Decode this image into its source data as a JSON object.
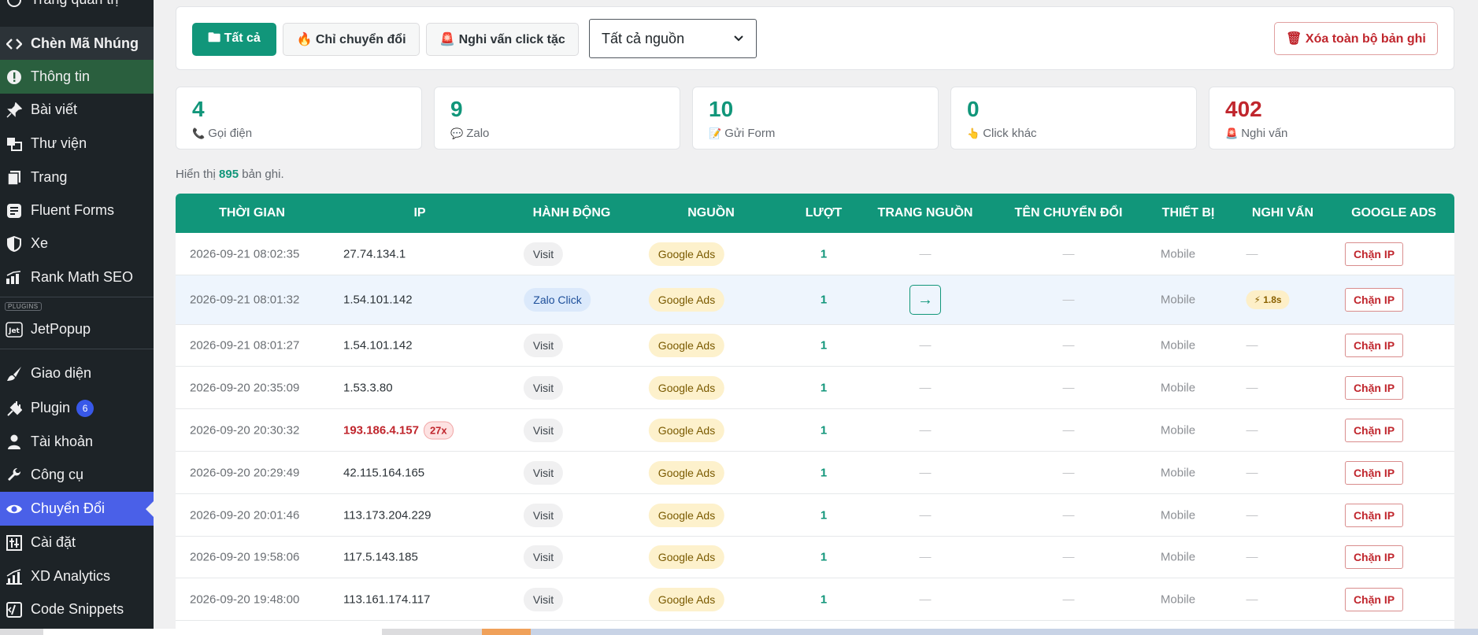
{
  "sidebar": {
    "items": [
      {
        "label": "Trang quản trị",
        "icon": "dashboard-icon"
      },
      {
        "label": "Chèn Mã Nhúng",
        "icon": "code-icon"
      },
      {
        "label": "Thông tin",
        "icon": "info-icon"
      },
      {
        "label": "Bài viết",
        "icon": "pin-icon"
      },
      {
        "label": "Thư viện",
        "icon": "media-icon"
      },
      {
        "label": "Trang",
        "icon": "page-icon"
      },
      {
        "label": "Fluent Forms",
        "icon": "form-icon"
      },
      {
        "label": "Xe",
        "icon": "shield-icon"
      },
      {
        "label": "Rank Math SEO",
        "icon": "chart-icon"
      },
      {
        "label": "JetPopup",
        "icon": "jet-icon"
      },
      {
        "label": "Giao diện",
        "icon": "brush-icon"
      },
      {
        "label": "Plugin",
        "icon": "plugin-icon",
        "badge": "6"
      },
      {
        "label": "Tài khoản",
        "icon": "user-icon"
      },
      {
        "label": "Công cụ",
        "icon": "wrench-icon"
      },
      {
        "label": "Chuyển Đổi",
        "icon": "eye-icon"
      },
      {
        "label": "Cài đặt",
        "icon": "settings-icon"
      },
      {
        "label": "XD Analytics",
        "icon": "analytics-icon"
      },
      {
        "label": "Code Snippets",
        "icon": "snippet-icon"
      }
    ],
    "plugins_tag": "PLUGINS"
  },
  "toolbar": {
    "filter_all": "🖿 Tất cả",
    "filter_conversion": "🔥 Chỉ chuyển đổi",
    "filter_suspicious": "🚨 Nghi vấn click tặc",
    "source_select": "Tất cả nguồn",
    "delete_all": "🗑 Xóa toàn bộ bản ghi"
  },
  "stats": [
    {
      "value": "4",
      "emoji": "📞",
      "label": "Gọi điện"
    },
    {
      "value": "9",
      "emoji": "💬",
      "label": "Zalo"
    },
    {
      "value": "10",
      "emoji": "📝",
      "label": "Gửi Form"
    },
    {
      "value": "0",
      "emoji": "👆",
      "label": "Click khác"
    },
    {
      "value": "402",
      "emoji": "🚨",
      "label": "Nghi vấn"
    }
  ],
  "showing": {
    "prefix": "Hiển thị",
    "count": "895",
    "suffix": "bản ghi."
  },
  "table": {
    "headers": [
      "THỜI GIAN",
      "IP",
      "HÀNH ĐỘNG",
      "NGUỒN",
      "LƯỢT",
      "TRANG NGUỒN",
      "TÊN CHUYỂN ĐỔI",
      "THIẾT BỊ",
      "NGHI VẤN",
      "GOOGLE ADS"
    ],
    "dash": "—",
    "rows": [
      {
        "time": "2026-09-21 08:02:35",
        "ip": "27.74.134.1",
        "action": "Visit",
        "source": "Google Ads",
        "turns": "1",
        "device": "Mobile",
        "block": "Chặn IP"
      },
      {
        "time": "2026-09-21 08:01:32",
        "ip": "1.54.101.142",
        "action": "Zalo Click",
        "source": "Google Ads",
        "turns": "1",
        "arrow": "→",
        "device": "Mobile",
        "suspect": "⚡ 1.8s",
        "block": "Chặn IP"
      },
      {
        "time": "2026-09-21 08:01:27",
        "ip": "1.54.101.142",
        "action": "Visit",
        "source": "Google Ads",
        "turns": "1",
        "device": "Mobile",
        "block": "Chặn IP"
      },
      {
        "time": "2026-09-20 20:35:09",
        "ip": "1.53.3.80",
        "action": "Visit",
        "source": "Google Ads",
        "turns": "1",
        "device": "Mobile",
        "block": "Chặn IP"
      },
      {
        "time": "2026-09-20 20:30:32",
        "ip": "193.186.4.157",
        "ip_count": "27x",
        "action": "Visit",
        "source": "Google Ads",
        "turns": "1",
        "device": "Mobile",
        "block": "Chặn IP"
      },
      {
        "time": "2026-09-20 20:29:49",
        "ip": "42.115.164.165",
        "action": "Visit",
        "source": "Google Ads",
        "turns": "1",
        "device": "Mobile",
        "block": "Chặn IP"
      },
      {
        "time": "2026-09-20 20:01:46",
        "ip": "113.173.204.229",
        "action": "Visit",
        "source": "Google Ads",
        "turns": "1",
        "device": "Mobile",
        "block": "Chặn IP"
      },
      {
        "time": "2026-09-20 19:58:06",
        "ip": "117.5.143.185",
        "action": "Visit",
        "source": "Google Ads",
        "turns": "1",
        "device": "Mobile",
        "block": "Chặn IP"
      },
      {
        "time": "2026-09-20 19:48:00",
        "ip": "113.161.174.117",
        "action": "Visit",
        "source": "Google Ads",
        "turns": "1",
        "device": "Mobile",
        "block": "Chặn IP"
      }
    ]
  },
  "colors": {
    "accent": "#11967a",
    "danger": "#c0262d",
    "sidebar": "#1d2327",
    "current": "#4a60e8"
  }
}
